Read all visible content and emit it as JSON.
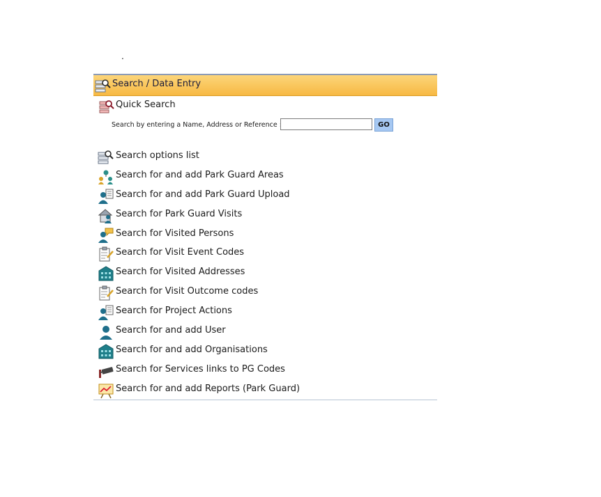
{
  "top_mark": ".",
  "panel": {
    "title": "Search / Data Entry",
    "header_icon": "search-list-icon"
  },
  "quick_search": {
    "title": "Quick Search",
    "icon": "quick-search-icon",
    "prompt": "Search by entering a Name, Address or Reference :",
    "input_value": "",
    "go_label": "GO"
  },
  "links": [
    {
      "label": "Search options list",
      "icon": "search-list-icon"
    },
    {
      "label": "Search for and add Park Guard Areas",
      "icon": "areas-icon"
    },
    {
      "label": "Search for and add Park Guard Upload",
      "icon": "user-document-icon"
    },
    {
      "label": "Search for Park Guard Visits",
      "icon": "house-person-icon"
    },
    {
      "label": "Search for Visited Persons",
      "icon": "person-speech-icon"
    },
    {
      "label": "Search for Visit Event Codes",
      "icon": "clipboard-pencil-icon"
    },
    {
      "label": "Search for Visited Addresses",
      "icon": "building-icon"
    },
    {
      "label": "Search for Visit Outcome codes",
      "icon": "clipboard-pencil-icon"
    },
    {
      "label": "Search for Project Actions",
      "icon": "user-document-icon"
    },
    {
      "label": "Search for and add User",
      "icon": "user-icon"
    },
    {
      "label": "Search for and add Organisations",
      "icon": "building-icon"
    },
    {
      "label": "Search for Services links to PG Codes",
      "icon": "camera-icon"
    },
    {
      "label": "Search for and add Reports (Park Guard)",
      "icon": "chart-board-icon"
    }
  ]
}
